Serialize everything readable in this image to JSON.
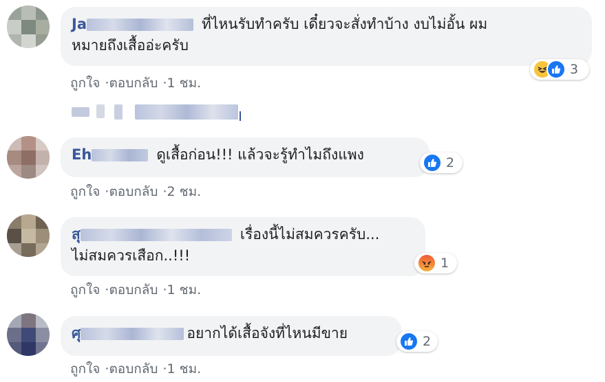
{
  "comments": [
    {
      "name_visible": "Ja",
      "text_line1": "ที่ไหนรับทำครับ เดี๋ยวจะสั่งทำบ้าง งบไม่อั้น ผม",
      "text_line2": "หมายถึงเสื้ออ่ะครับ",
      "reaction_count": "3",
      "reaction_types": [
        "haha-icon",
        "like-icon"
      ],
      "like_label": "ถูกใจ",
      "reply_label": "ตอบกลับ",
      "time": "1 ชม."
    },
    {
      "name_visible": "Eh",
      "text_line1": "ดูเสื้อก่อน!!! แล้วจะรู้ทำไมถึงแพง",
      "reaction_count": "2",
      "reaction_types": [
        "like-icon"
      ],
      "like_label": "ถูกใจ",
      "reply_label": "ตอบกลับ",
      "time": "2 ชม."
    },
    {
      "name_visible": "สุ",
      "text_line1": "เรื่องนี้ไม่สมควรครับ...",
      "text_line2": "ไม่สมควรเสือก..!!!",
      "reaction_count": "1",
      "reaction_types": [
        "angry-icon"
      ],
      "like_label": "ถูกใจ",
      "reply_label": "ตอบกลับ",
      "time": "1 ชม."
    },
    {
      "name_visible": "ศุ",
      "text_line1": "อยากได้เสื้อจังที่ไหนมีขาย",
      "reaction_count": "2",
      "reaction_types": [
        "like-icon"
      ],
      "like_label": "ถูกใจ",
      "reply_label": "ตอบกลับ",
      "time": "1 ชม."
    }
  ],
  "separator": "·",
  "colors": {
    "name": "#385898",
    "bubble": "#f2f3f5",
    "meta": "#606770",
    "like": "#1877f2"
  }
}
